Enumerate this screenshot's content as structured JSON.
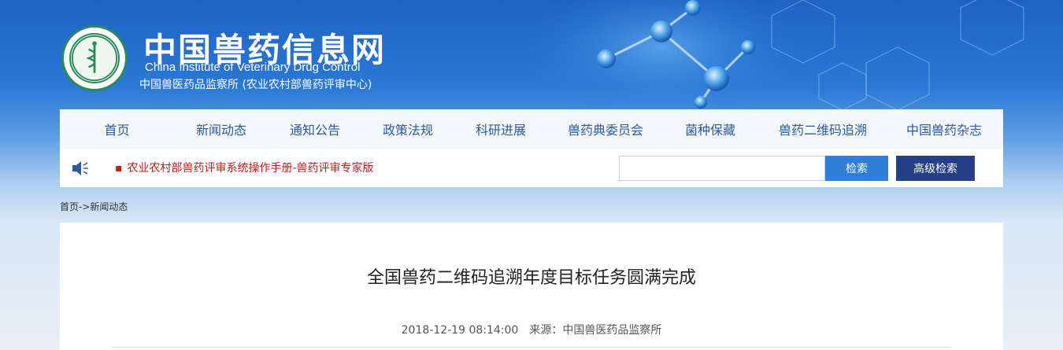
{
  "header": {
    "title": "中国兽药信息网",
    "subtitle_en": "China Institute of Veterinary Drug Control",
    "subtitle_cn": "中国兽医药品监察所 (农业农村部兽药评审中心)"
  },
  "nav": {
    "items": [
      "首页",
      "新闻动态",
      "通知公告",
      "政策法规",
      "科研进展",
      "兽药典委员会",
      "菌种保藏",
      "兽药二维码追溯",
      "中国兽药杂志"
    ]
  },
  "notice": {
    "text": "农业农村部兽药评审系统操作手册-兽药评审专家版"
  },
  "search": {
    "placeholder": "",
    "search_label": "检索",
    "advanced_label": "高级检索"
  },
  "breadcrumb": {
    "home": "首页",
    "sep": "->",
    "current": "新闻动态"
  },
  "article": {
    "title": "全国兽药二维码追溯年度目标任务圆满完成",
    "date": "2018-12-19 08:14:00",
    "source_label": "来源：",
    "source": "中国兽医药品监察所"
  },
  "colors": {
    "banner": "#1f62c4",
    "nav_text": "#2c5aa0",
    "notice": "#c41a1a",
    "search_button": "#2f7fd8",
    "advanced_button": "#233f86"
  }
}
